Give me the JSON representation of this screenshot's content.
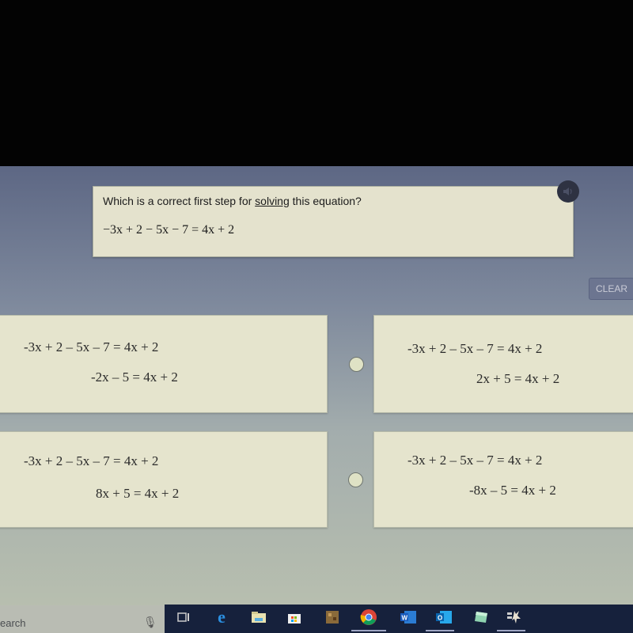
{
  "question": {
    "prompt_before": "Which is a correct first step for ",
    "prompt_underlined": "solving",
    "prompt_after": " this equation?",
    "equation": "−3x + 2 − 5x − 7 = 4x + 2"
  },
  "buttons": {
    "clear_label": "CLEAR",
    "audio_icon": "speaker-icon"
  },
  "choices": [
    {
      "line1": "-3x + 2 – 5x – 7 = 4x + 2",
      "line2": "-2x – 5 = 4x + 2",
      "selected": false
    },
    {
      "line1": "-3x + 2 – 5x – 7 = 4x + 2",
      "line2": "2x + 5 = 4x + 2",
      "selected": false
    },
    {
      "line1": "-3x + 2 – 5x – 7 = 4x + 2",
      "line2": "8x + 5 = 4x + 2",
      "selected": false
    },
    {
      "line1": "-3x + 2 – 5x – 7 = 4x + 2",
      "line2": "-8x – 5 = 4x + 2",
      "selected": false
    }
  ],
  "taskbar": {
    "search_text": "earch",
    "icons": [
      "microphone-icon",
      "task-view-icon",
      "edge-icon",
      "file-explorer-icon",
      "store-icon",
      "minecraft-icon",
      "chrome-icon",
      "word-icon",
      "outlook-icon",
      "notes-icon",
      "app-icon"
    ]
  }
}
